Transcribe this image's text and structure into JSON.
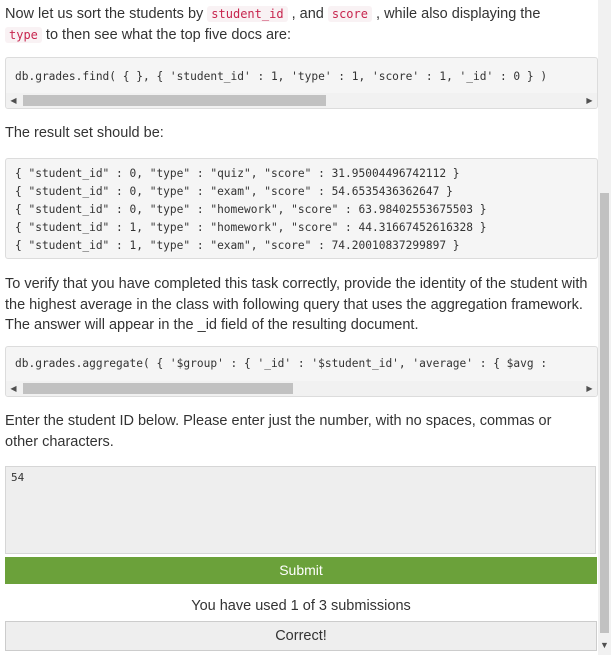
{
  "intro": {
    "part1": "Now let us sort the students by ",
    "code1": "student_id",
    "part2": " , and ",
    "code2": "score",
    "part3": " , while also displaying the ",
    "code3": "type",
    "part4": " to then see what the top five docs are:"
  },
  "find_query": {
    "code": "db.grades.find( { }, { 'student_id' : 1, 'type' : 1, 'score' : 1, '_id' : 0 } )"
  },
  "result_intro": "The result set should be:",
  "result_set": [
    "{ \"student_id\" : 0, \"type\" : \"quiz\", \"score\" : 31.95004496742112 }",
    "{ \"student_id\" : 0, \"type\" : \"exam\", \"score\" : 54.6535436362647 }",
    "{ \"student_id\" : 0, \"type\" : \"homework\", \"score\" : 63.98402553675503 }",
    "{ \"student_id\" : 1, \"type\" : \"homework\", \"score\" : 44.31667452616328 }",
    "{ \"student_id\" : 1, \"type\" : \"exam\", \"score\" : 74.20010837299897 }"
  ],
  "verify_text": "To verify that you have completed this task correctly, provide the identity of the student with the highest average in the class with following query that uses the aggregation framework. The answer will appear in the _id field of the resulting document.",
  "aggregate_query": {
    "code": "db.grades.aggregate( { '$group' : { '_id' : '$student_id', 'average' : { $avg :"
  },
  "enter_text": "Enter the student ID below. Please enter just the number, with no spaces, commas or other characters.",
  "answer": {
    "value": "54"
  },
  "submit_label": "Submit",
  "submissions_text": "You have used 1 of 3 submissions",
  "result_label": "Correct!",
  "colors": {
    "submit_bg": "#6ba13a",
    "inline_code": "#c7254e"
  },
  "icons": {
    "scroll_left": "◀",
    "scroll_right": "▶",
    "scroll_down": "▼"
  }
}
